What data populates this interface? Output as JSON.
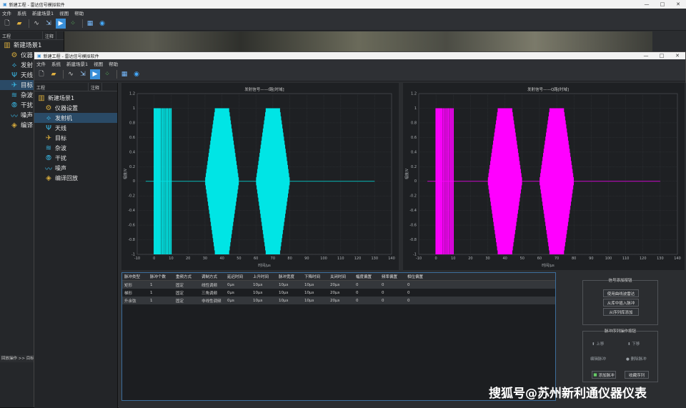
{
  "back_window": {
    "title": "新建工程 - 雷达信号模拟软件",
    "menu": [
      "文件",
      "系统",
      "新建场景1",
      "视图",
      "帮助"
    ],
    "tree_header": [
      "工程",
      "注释"
    ],
    "tree": [
      "新建场景1",
      "仪器",
      "发射",
      "天线",
      "目标",
      "杂波",
      "干扰",
      "噪声",
      "编译"
    ],
    "status": "回放操作 >> 目标"
  },
  "front_window": {
    "title": "新建工程 - 雷达信号模拟软件",
    "menu": [
      "文件",
      "系统",
      "新建场景1",
      "视图",
      "帮助"
    ],
    "tree_header": [
      "工程",
      "注释"
    ],
    "tree": [
      "新建场景1",
      "仪器设置",
      "发射机",
      "天线",
      "目标",
      "杂波",
      "干扰",
      "噪声",
      "编译回放"
    ]
  },
  "charts": {
    "left_title": "发射信号——I路[时域]",
    "right_title": "发射信号——Q路[时域]",
    "ylabel": "幅度/V",
    "xlabel": "时间/μs",
    "x_ticks": [
      "-10",
      "0",
      "10",
      "20",
      "30",
      "40",
      "50",
      "60",
      "70",
      "80",
      "90",
      "100",
      "110",
      "120",
      "130",
      "140"
    ],
    "y_ticks": [
      "1.2",
      "1",
      "0.8",
      "0.6",
      "0.4",
      "0.2",
      "0",
      "-0.2",
      "-0.4",
      "-0.6",
      "-0.8",
      "-1"
    ],
    "colors": {
      "i_channel": "#00e5e5",
      "q_channel": "#ff00ff"
    }
  },
  "chart_data": [
    {
      "type": "line",
      "title": "发射信号——I路[时域]",
      "xlabel": "时间/μs",
      "ylabel": "幅度/V",
      "xlim": [
        -10,
        140
      ],
      "ylim": [
        -1,
        1.2
      ],
      "series": [
        {
          "values": [
            {
              "x_start": 0,
              "x_end": 10,
              "shape": "rect",
              "amplitude": 1
            },
            {
              "x_start": 30,
              "x_end": 50,
              "shape": "trapezoid",
              "amplitude": 1
            },
            {
              "x_start": 60,
              "x_end": 80,
              "shape": "trapezoid",
              "amplitude": 1
            }
          ]
        }
      ]
    },
    {
      "type": "line",
      "title": "发射信号——Q路[时域]",
      "xlabel": "时间/μs",
      "ylabel": "幅度/V",
      "xlim": [
        -10,
        140
      ],
      "ylim": [
        -1,
        1.2
      ],
      "series": [
        {
          "values": [
            {
              "x_start": 0,
              "x_end": 10,
              "shape": "rect",
              "amplitude": 1
            },
            {
              "x_start": 30,
              "x_end": 50,
              "shape": "trapezoid",
              "amplitude": 1
            },
            {
              "x_start": 60,
              "x_end": 80,
              "shape": "trapezoid",
              "amplitude": 1
            }
          ]
        }
      ]
    }
  ],
  "table": {
    "headers": [
      "脉冲类型",
      "脉冲个数",
      "重频方式",
      "调制方式",
      "延迟时间",
      "上升时间",
      "脉冲宽度",
      "下降时间",
      "关闭时间",
      "幅度偏置",
      "频率偏置",
      "相位偏置"
    ],
    "rows": [
      [
        "矩形",
        "1",
        "固定",
        "线性调频",
        "0μs",
        "10μs",
        "10μs",
        "10μs",
        "20μs",
        "0",
        "0",
        "0"
      ],
      [
        "梯形",
        "1",
        "固定",
        "三角调频",
        "0μs",
        "10μs",
        "10μs",
        "10μs",
        "20μs",
        "0",
        "0",
        "0"
      ],
      [
        "升余弦",
        "1",
        "固定",
        "非线性调频",
        "0μs",
        "10μs",
        "10μs",
        "10μs",
        "20μs",
        "0",
        "0",
        "0"
      ]
    ]
  },
  "signal_panel": {
    "title": "信号添加按钮",
    "buttons": [
      "使用曲线波雷达",
      "从库中插入脉冲",
      "从序列库添加"
    ]
  },
  "seq_panel": {
    "title": "脉冲序列操作按钮",
    "up": "上移",
    "down": "下移",
    "edit": "编辑脉冲",
    "delete": "删除脉冲",
    "add": "添加脉冲",
    "save": "收藏序列"
  },
  "watermark": "搜狐号@苏州新利通仪器仪表"
}
